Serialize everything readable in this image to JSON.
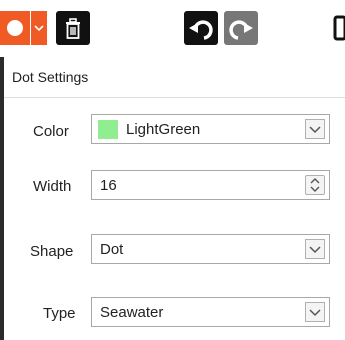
{
  "toolbar": {
    "icons": [
      "dot-icon",
      "chevron-down-icon",
      "trash-icon",
      "undo-icon",
      "redo-icon"
    ],
    "accent": "#f05a24"
  },
  "panel": {
    "title": "Dot Settings",
    "color": {
      "label": "Color",
      "value": "LightGreen",
      "swatch": "#90ee90"
    },
    "width": {
      "label": "Width",
      "value": "16"
    },
    "shape": {
      "label": "Shape",
      "value": "Dot"
    },
    "type": {
      "label": "Type",
      "value": "Seawater"
    }
  }
}
